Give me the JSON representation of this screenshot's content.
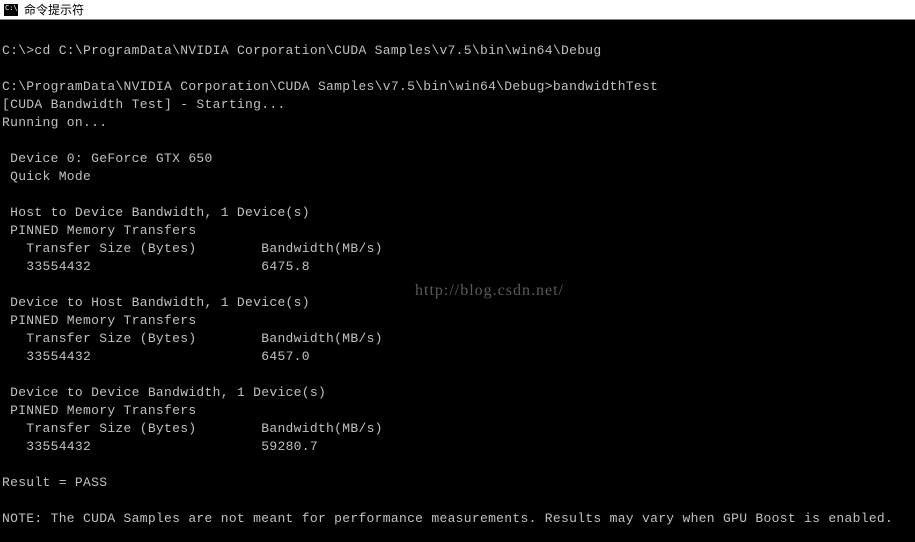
{
  "titlebar": {
    "title": "命令提示符"
  },
  "terminal": {
    "line1_prompt": "C:\\>",
    "line1_cmd": "cd C:\\ProgramData\\NVIDIA Corporation\\CUDA Samples\\v7.5\\bin\\win64\\Debug",
    "line2_prompt": "C:\\ProgramData\\NVIDIA Corporation\\CUDA Samples\\v7.5\\bin\\win64\\Debug>",
    "line2_cmd": "bandwidthTest",
    "starting": "[CUDA Bandwidth Test] - Starting...",
    "running": "Running on...",
    "device": " Device 0: GeForce GTX 650",
    "mode": " Quick Mode",
    "h2d_title": " Host to Device Bandwidth, 1 Device(s)",
    "pinned": " PINNED Memory Transfers",
    "header_transfer": "   Transfer Size (Bytes)",
    "header_bandwidth": "Bandwidth(MB/s)",
    "h2d_size": "   33554432",
    "h2d_bw": "6475.8",
    "d2h_title": " Device to Host Bandwidth, 1 Device(s)",
    "d2h_size": "   33554432",
    "d2h_bw": "6457.0",
    "d2d_title": " Device to Device Bandwidth, 1 Device(s)",
    "d2d_size": "   33554432",
    "d2d_bw": "59280.7",
    "result": "Result = PASS",
    "note": "NOTE: The CUDA Samples are not meant for performance measurements. Results may vary when GPU Boost is enabled."
  },
  "watermark": {
    "text": "http://blog.csdn.net/"
  }
}
